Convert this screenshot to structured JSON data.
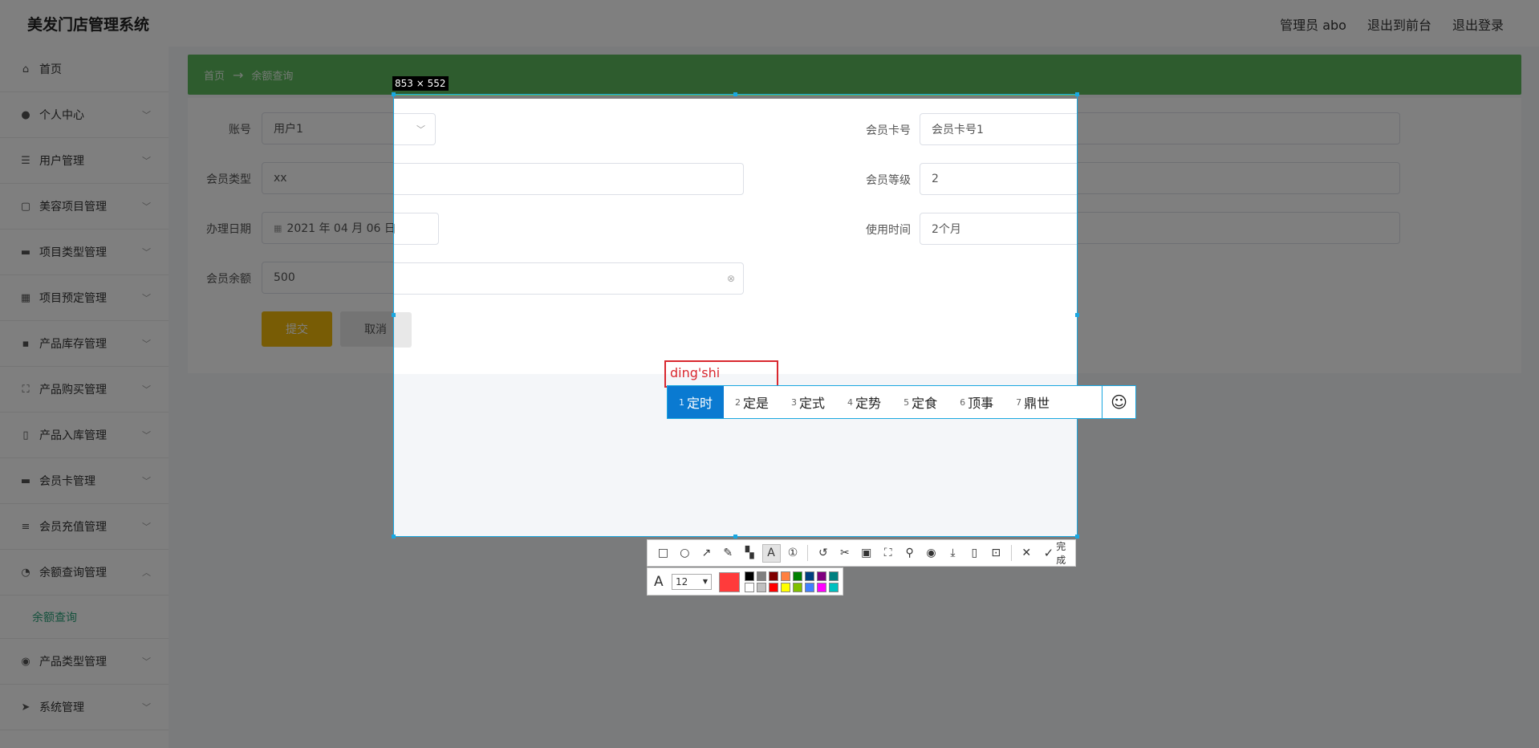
{
  "app": {
    "title": "美发门店管理系统"
  },
  "header": {
    "admin": "管理员 abo",
    "to_front": "退出到前台",
    "logout": "退出登录"
  },
  "sidebar": {
    "items": [
      {
        "label": "首页",
        "icon": "home-icon"
      },
      {
        "label": "个人中心",
        "icon": "user-icon"
      },
      {
        "label": "用户管理",
        "icon": "sliders-icon"
      },
      {
        "label": "美容项目管理",
        "icon": "chat-icon"
      },
      {
        "label": "项目类型管理",
        "icon": "monitor-icon"
      },
      {
        "label": "项目预定管理",
        "icon": "grid-icon"
      },
      {
        "label": "产品库存管理",
        "icon": "message-icon"
      },
      {
        "label": "产品购买管理",
        "icon": "scan-icon"
      },
      {
        "label": "产品入库管理",
        "icon": "phone-icon"
      },
      {
        "label": "会员卡管理",
        "icon": "card-icon"
      },
      {
        "label": "会员充值管理",
        "icon": "list-icon"
      },
      {
        "label": "余额查询管理",
        "icon": "pie-icon"
      },
      {
        "label": "产品类型管理",
        "icon": "compass-icon"
      },
      {
        "label": "系统管理",
        "icon": "send-icon"
      }
    ],
    "sub_item": "余额查询"
  },
  "breadcrumb": {
    "home": "首页",
    "current": "余额查询"
  },
  "form": {
    "account": {
      "label": "账号",
      "value": "用户1"
    },
    "card_no": {
      "label": "会员卡号",
      "value": "会员卡号1"
    },
    "type": {
      "label": "会员类型",
      "value": "xx"
    },
    "level": {
      "label": "会员等级",
      "value": "2"
    },
    "date": {
      "label": "办理日期",
      "value": "2021 年 04 月 06 日"
    },
    "duration": {
      "label": "使用时间",
      "value": "2个月"
    },
    "balance": {
      "label": "会员余额",
      "value": "500"
    },
    "submit": "提交",
    "cancel": "取消"
  },
  "capture": {
    "size_label": "853 × 552",
    "text_annotation": "ding'shi",
    "ime_candidates": [
      {
        "n": "1",
        "text": "定时"
      },
      {
        "n": "2",
        "text": "定是"
      },
      {
        "n": "3",
        "text": "定式"
      },
      {
        "n": "4",
        "text": "定势"
      },
      {
        "n": "5",
        "text": "定食"
      },
      {
        "n": "6",
        "text": "顶事"
      },
      {
        "n": "7",
        "text": "鼎世"
      }
    ],
    "emoji": "☺",
    "done_label": "完成",
    "font_size": "12",
    "current_color": "#ff3b3b",
    "palette_top": [
      "#000000",
      "#808080",
      "#800000",
      "#ff8040",
      "#008000",
      "#004080",
      "#800080",
      "#008080"
    ],
    "palette_bottom": [
      "#ffffff",
      "#c0c0c0",
      "#ff0000",
      "#ffff00",
      "#80c000",
      "#4080ff",
      "#ff00ff",
      "#00c0c0"
    ]
  }
}
